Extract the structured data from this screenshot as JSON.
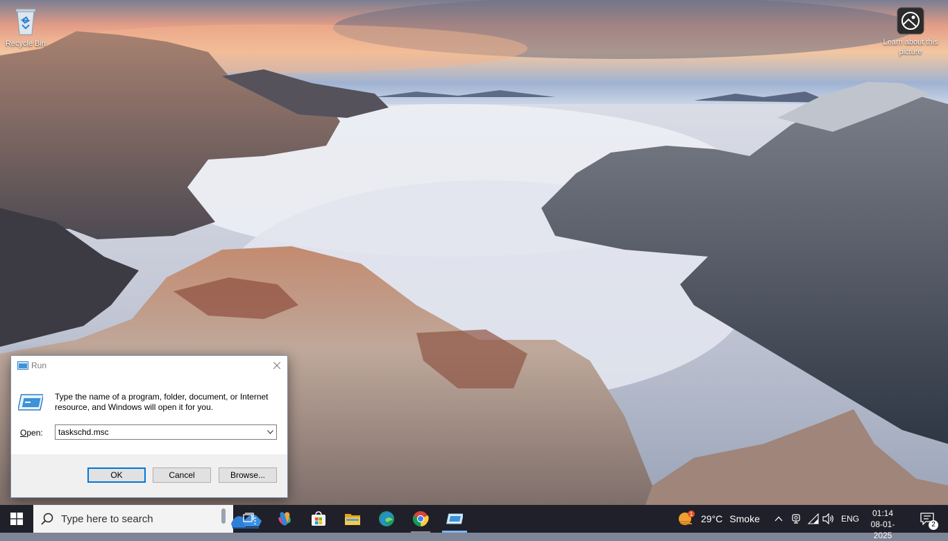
{
  "desktop": {
    "icons": [
      {
        "label": "Recycle Bin",
        "icon": "recycle-bin-icon"
      },
      {
        "label": "Learn about this picture",
        "icon": "learn-about-picture-icon"
      }
    ]
  },
  "run_dialog": {
    "title": "Run",
    "description": "Type the name of a program, folder, document, or Internet resource, and Windows will open it for you.",
    "open_label_mnemonic": "O",
    "open_label_rest": "pen:",
    "input_value": "taskschd.msc",
    "buttons": {
      "ok": "OK",
      "cancel": "Cancel",
      "browse": "Browse..."
    }
  },
  "taskbar": {
    "search_placeholder": "Type here to search",
    "apps": [
      "copilot-icon",
      "microsoft-store-icon",
      "file-explorer-icon",
      "edge-icon",
      "chrome-icon",
      "run-icon"
    ],
    "weather": {
      "temperature": "29°C",
      "condition": "Smoke",
      "alert_count": "1"
    },
    "language": "ENG",
    "time": "01:14",
    "date": "08-01-2025",
    "notification_count": "2"
  },
  "colors": {
    "taskbar_bg": "#1f2029",
    "accent": "#0078d7",
    "active_indicator": "#7fb4f0"
  }
}
